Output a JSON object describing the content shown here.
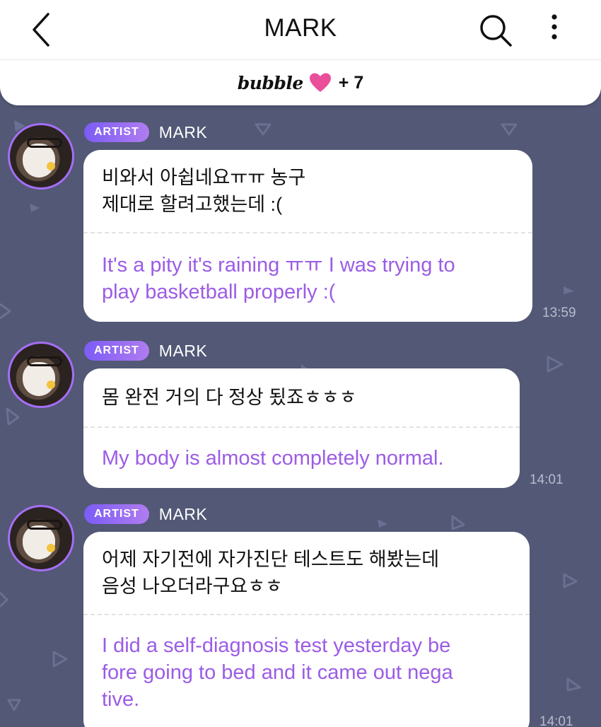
{
  "header": {
    "title": "MARK",
    "back_icon": "chevron-left-icon",
    "search_icon": "search-icon",
    "more_icon": "more-vertical-icon"
  },
  "bubble_bar": {
    "logo": "bubble",
    "heart_color": "#e94f9a",
    "count_label": "+ 7"
  },
  "colors": {
    "chat_background": "#525876",
    "accent_purple": "#9b5ce6",
    "badge_gradient_start": "#7b5cf5",
    "badge_gradient_end": "#b07cf0",
    "time_text": "#b8bccd"
  },
  "messages": [
    {
      "badge": "ARTIST",
      "sender": "MARK",
      "korean": [
        "비와서 아쉽네요ㅠㅠ 농구",
        "제대로 할려고했는데 :("
      ],
      "translation": [
        "It's a pity it's raining ㅠㅠ I was trying to",
        " play basketball properly :("
      ],
      "time": "13:59"
    },
    {
      "badge": "ARTIST",
      "sender": "MARK",
      "korean": [
        "몸 완전 거의 다 정상 됬죠ㅎㅎㅎ"
      ],
      "translation": [
        "My body is almost completely normal."
      ],
      "time": "14:01"
    },
    {
      "badge": "ARTIST",
      "sender": "MARK",
      "korean": [
        "어제 자기전에 자가진단 테스트도 해봤는데",
        "음성 나오더라구요ㅎㅎ"
      ],
      "translation": [
        "I did a self-diagnosis test yesterday be",
        "fore going to bed and it came out nega",
        "tive."
      ],
      "time": "14:01"
    }
  ]
}
